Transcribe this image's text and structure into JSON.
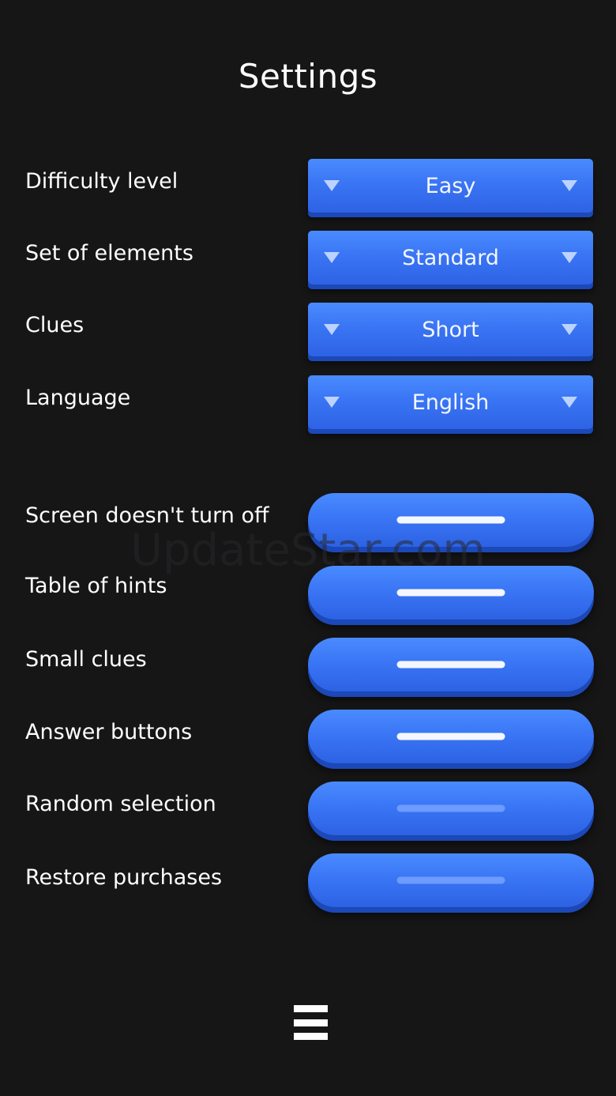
{
  "header": {
    "title": "Settings"
  },
  "dropdowns": [
    {
      "label": "Difficulty level",
      "value": "Easy"
    },
    {
      "label": "Set of elements",
      "value": "Standard"
    },
    {
      "label": "Clues",
      "value": "Short"
    },
    {
      "label": "Language",
      "value": "English"
    }
  ],
  "toggles": [
    {
      "label": "Screen doesn't turn off",
      "state": "on"
    },
    {
      "label": "Table of hints",
      "state": "on"
    },
    {
      "label": "Small clues",
      "state": "on"
    },
    {
      "label": "Answer buttons",
      "state": "on"
    },
    {
      "label": "Random selection",
      "state": "off"
    },
    {
      "label": "Restore purchases",
      "state": "off"
    }
  ],
  "watermark": "UpdateStar.com",
  "footer": {
    "menu_icon": "hamburger-menu-icon"
  },
  "colors": {
    "background": "#161617",
    "accent": "#3a75f4",
    "accent_shadow": "#1c48b8",
    "text": "#ffffff"
  }
}
